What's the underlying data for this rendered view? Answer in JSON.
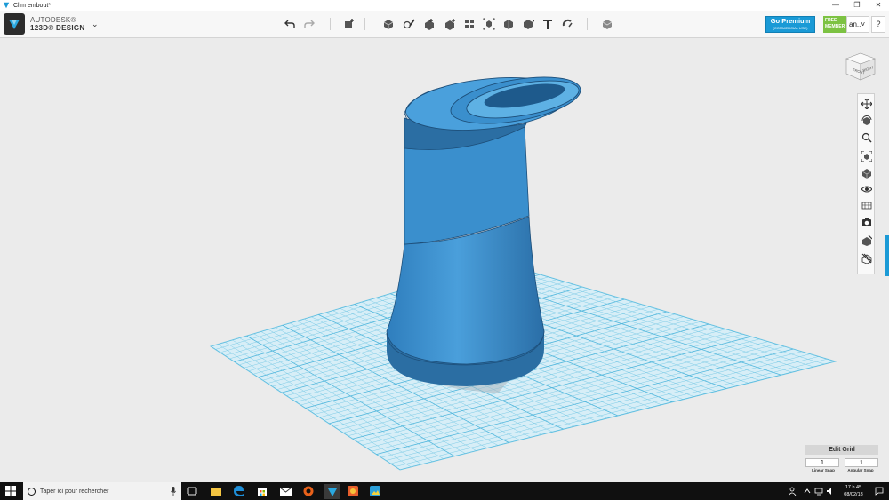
{
  "window": {
    "title": "Clim embout*",
    "controls": [
      "—",
      "❐",
      "✕"
    ]
  },
  "brand": {
    "line1": "AUTODESK®",
    "line2": "123D® DESIGN"
  },
  "toolbar": {
    "tools": [
      "undo",
      "redo",
      "transform",
      "primitives",
      "sketch",
      "construct",
      "modify",
      "pattern",
      "grouping",
      "combine",
      "measure",
      "text",
      "snap",
      "material"
    ]
  },
  "premium": {
    "label": "Go Premium",
    "sublabel": "(COMMERCIAL USE)"
  },
  "free_badge": {
    "line1": "FREE",
    "line2": "MEMBER"
  },
  "user": {
    "name": "an..",
    "caret": "˅"
  },
  "help": {
    "label": "?"
  },
  "viewcube": {
    "front": "FRONT",
    "right": "RIGHT"
  },
  "nav_tools": [
    "pan-icon",
    "orbit-icon",
    "zoom-icon",
    "fit-icon",
    "views-icon",
    "visibility-icon",
    "material-display-icon",
    "camera-icon",
    "grid-toggle-icon",
    "snap-icon"
  ],
  "edit_grid": {
    "header": "Edit Grid",
    "linear_value": "1",
    "angular_value": "1",
    "linear_label": "Linear Snap",
    "angular_label": "Angular Snap"
  },
  "taskbar": {
    "search_placeholder": "Taper ici pour rechercher",
    "time": "17 h 45",
    "date": "08/02/18"
  },
  "colors": {
    "model": "#3f93cf",
    "model_dark": "#2b6ea3",
    "grid": "#7dcbe6",
    "accent": "#1b9ad6"
  }
}
